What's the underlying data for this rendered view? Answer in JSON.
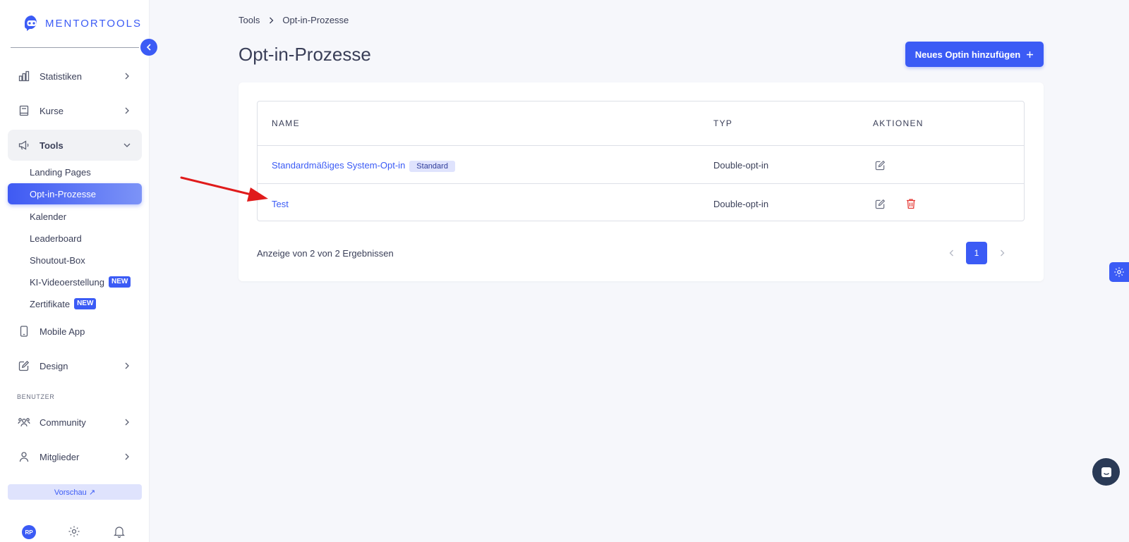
{
  "brand": {
    "name": "MENTORTOOLS",
    "color": "#3b5bf5"
  },
  "sidebar": {
    "items": [
      {
        "label": "Statistiken",
        "icon": "bar-chart-icon"
      },
      {
        "label": "Kurse",
        "icon": "book-icon"
      },
      {
        "label": "Tools",
        "icon": "megaphone-icon"
      },
      {
        "label": "Mobile App",
        "icon": "phone-icon"
      },
      {
        "label": "Design",
        "icon": "pencil-icon"
      },
      {
        "label": "Community",
        "icon": "users-icon"
      },
      {
        "label": "Mitglieder",
        "icon": "user-icon"
      }
    ],
    "tools_sub": [
      {
        "label": "Landing Pages"
      },
      {
        "label": "Opt-in-Prozesse"
      },
      {
        "label": "Kalender"
      },
      {
        "label": "Leaderboard"
      },
      {
        "label": "Shoutout-Box"
      },
      {
        "label": "KI-Videoerstellung",
        "badge": "NEW"
      },
      {
        "label": "Zertifikate",
        "badge": "NEW"
      }
    ],
    "section_label": "BENUTZER",
    "preview_label": "Vorschau ↗",
    "avatar_initials": "RP"
  },
  "breadcrumb": {
    "root": "Tools",
    "current": "Opt-in-Prozesse"
  },
  "page_title": "Opt-in-Prozesse",
  "add_button_label": "Neues Optin hinzufügen",
  "table": {
    "headers": {
      "name": "NAME",
      "type": "TYP",
      "actions": "AKTIONEN"
    },
    "rows": [
      {
        "name": "Standardmäßiges System-Opt-in",
        "badge": "Standard",
        "type": "Double-opt-in"
      },
      {
        "name": "Test",
        "type": "Double-opt-in"
      }
    ]
  },
  "result_text": "Anzeige von 2 von 2 Ergebnissen",
  "pagination": {
    "current_page": "1"
  }
}
